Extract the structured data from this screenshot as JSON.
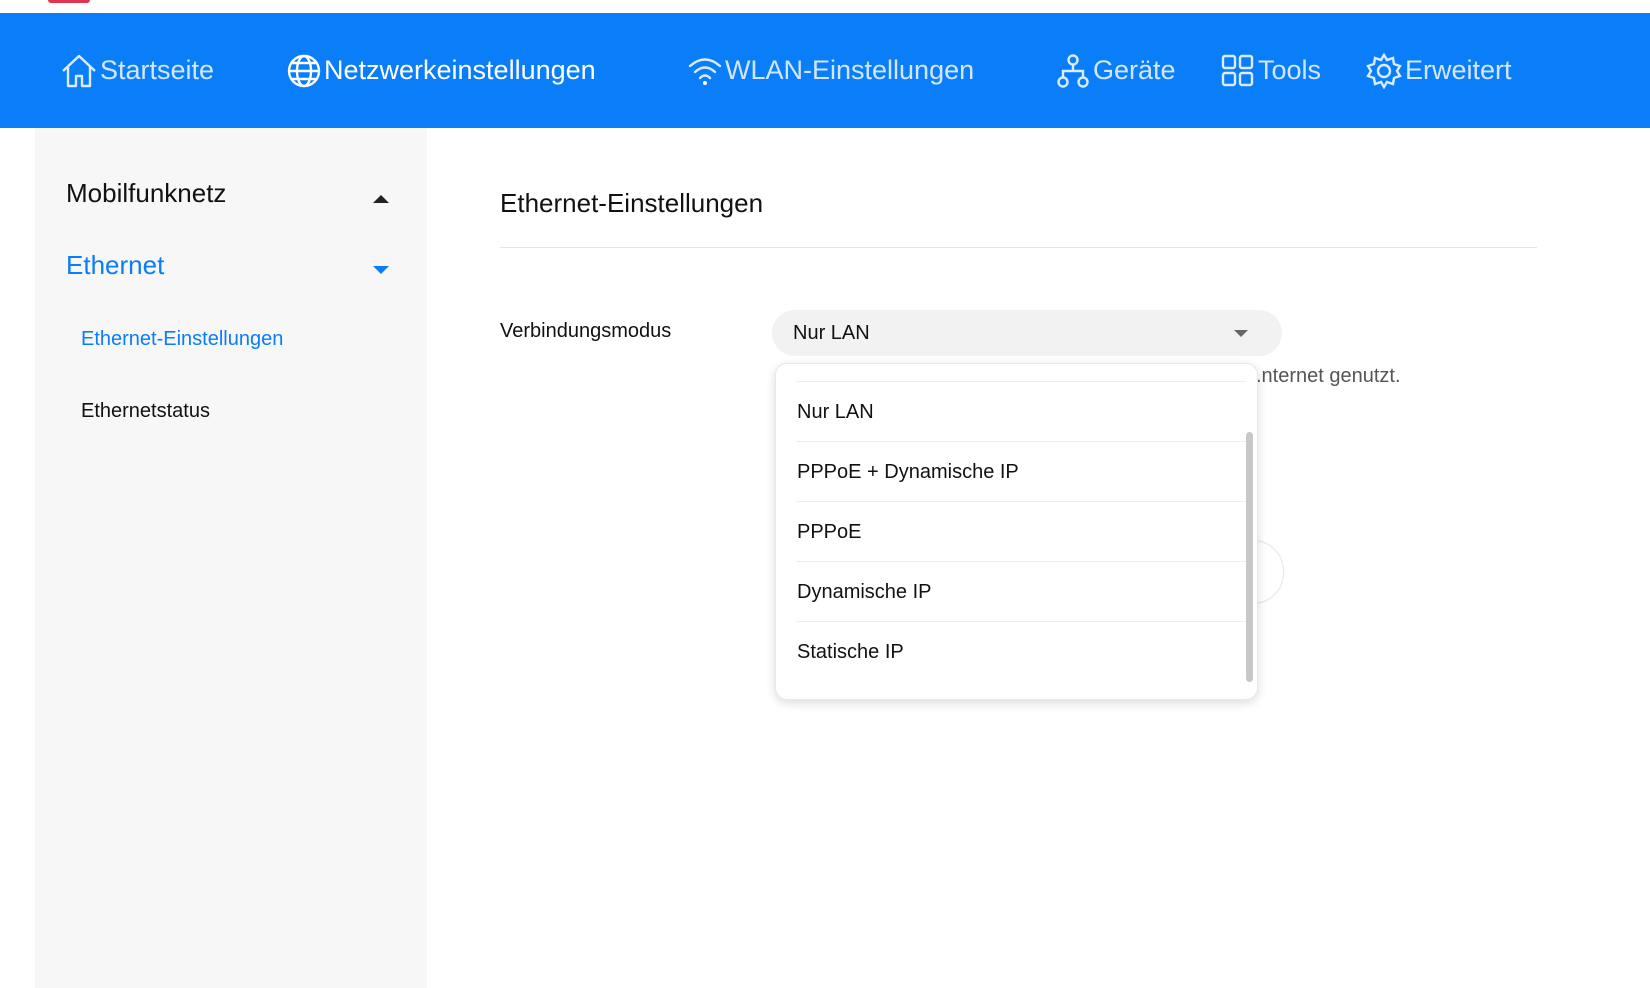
{
  "colors": {
    "brand_blue": "#0a7df8",
    "sidebar_bg": "#f7f7f7",
    "select_bg": "#f2f2f2",
    "logo_accent": "#e0334f"
  },
  "nav": {
    "items": [
      {
        "label": "Startseite",
        "icon": "home-icon",
        "active": false
      },
      {
        "label": "Netzwerkeinstellungen",
        "icon": "globe-icon",
        "active": true
      },
      {
        "label": "WLAN-Einstellungen",
        "icon": "wifi-icon",
        "active": false
      },
      {
        "label": "Geräte",
        "icon": "network-devices-icon",
        "active": false
      },
      {
        "label": "Tools",
        "icon": "grid-tools-icon",
        "active": false
      },
      {
        "label": "Erweitert",
        "icon": "gear-icon",
        "active": false
      }
    ]
  },
  "sidebar": {
    "groups": [
      {
        "label": "Mobilfunknetz",
        "expanded": false,
        "icon": "caret-up-icon"
      },
      {
        "label": "Ethernet",
        "expanded": true,
        "icon": "caret-down-icon",
        "items": [
          {
            "label": "Ethernet-Einstellungen",
            "active": true
          },
          {
            "label": "Ethernetstatus",
            "active": false
          }
        ]
      }
    ]
  },
  "main": {
    "title": "Ethernet-Einstellungen",
    "connection_mode": {
      "label": "Verbindungsmodus",
      "value": "Nur LAN",
      "hint_visible_fragment": ".nternet genutzt."
    },
    "dropdown": {
      "options": [
        "Nur LAN",
        "PPPoE + Dynamische IP",
        "PPPoE",
        "Dynamische IP",
        "Statische IP"
      ]
    }
  }
}
